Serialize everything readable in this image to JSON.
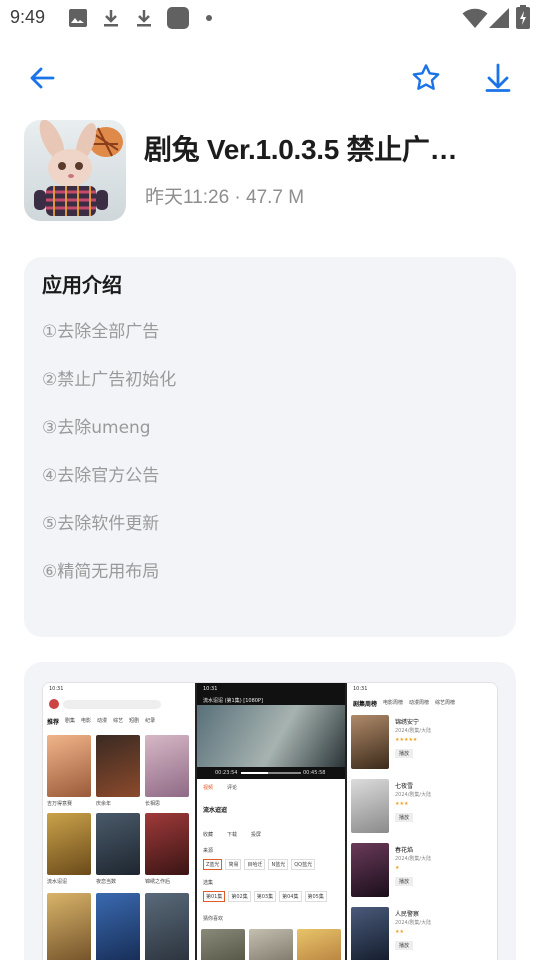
{
  "status_bar": {
    "time": "9:49",
    "icons": [
      "image-icon",
      "download-icon",
      "download-icon",
      "app-square-icon",
      "dot-icon",
      "wifi-icon",
      "signal-icon",
      "battery-charging-icon"
    ]
  },
  "toolbar": {
    "back_icon": "arrow-left-icon",
    "favorite_icon": "star-outline-icon",
    "download_icon": "download-arrow-icon",
    "accent_color": "#1a73e8"
  },
  "app": {
    "title": "剧兔 Ver.1.0.3.5 禁止广…",
    "meta": "昨天11:26 · 47.7 M"
  },
  "description": {
    "heading": "应用介绍",
    "items": [
      "①去除全部广告",
      "②禁止广告初始化",
      "③去除umeng",
      "④去除官方公告",
      "⑤去除软件更新",
      "⑥精简无用布局"
    ]
  },
  "screenshots": {
    "phone1": {
      "time": "10:31",
      "tabs": [
        "推荐",
        "剧集",
        "电影",
        "动漫",
        "综艺",
        "短剧",
        "纪录"
      ],
      "posters": [
        "吉万得意赛",
        "庆余年",
        "长相思",
        "流水迢迢",
        "夜恋当数",
        "锦绣之作后"
      ]
    },
    "phone2": {
      "time": "10:31",
      "title": "流水迢迢 (第1集) [1080P]",
      "time_code": "00:23:54",
      "duration": "00:45:58",
      "tabs": [
        "视频",
        "评论"
      ],
      "show_name": "流水迢迢",
      "actions": [
        "收藏",
        "下载",
        "投屏"
      ],
      "source_label": "来源",
      "sources": [
        "Z蓝光",
        "简易",
        "目哈迁",
        "N蓝光",
        "QQ蓝光",
        "审汉 |电"
      ],
      "episode_label": "选集",
      "episodes": [
        "第01集",
        "第02集",
        "第03集",
        "第04集",
        "第05集"
      ],
      "recommend_label": "猜你喜欢"
    },
    "phone3": {
      "time": "10:31",
      "tabs": [
        "剧集周榜",
        "电影周榜",
        "动漫周榜",
        "综艺周榜"
      ],
      "items": [
        {
          "name": "锦绣安宁",
          "meta": "2024/剧集/大陆"
        },
        {
          "name": "七夜雪",
          "meta": "2024/剧集/大陆"
        },
        {
          "name": "春花焰",
          "meta": "2024/剧集/大陆"
        },
        {
          "name": "人民警察",
          "meta": "2024/剧集/大陆"
        }
      ],
      "button_label": "播放"
    }
  }
}
